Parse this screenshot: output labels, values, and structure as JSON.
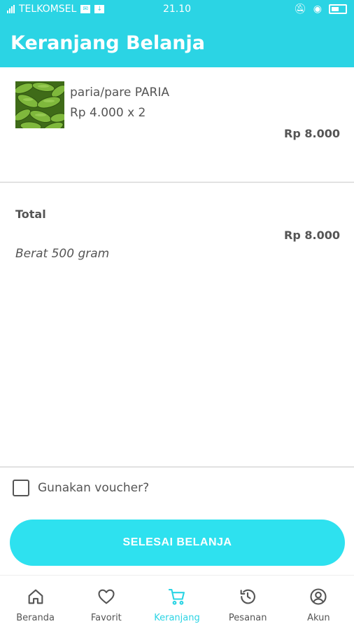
{
  "status_bar": {
    "carrier": "TELKOMSEL",
    "time": "21.10"
  },
  "header": {
    "title": "Keranjang Belanja"
  },
  "cart": {
    "items": [
      {
        "name": "paria/pare PARIA",
        "price_qty": "Rp 4.000 x 2",
        "subtotal": "Rp 8.000",
        "image": "bitter-gourd-photo"
      }
    ],
    "total_label": "Total",
    "total_value": "Rp 8.000",
    "weight": "Berat 500 gram"
  },
  "voucher": {
    "label": "Gunakan voucher?",
    "checked": false
  },
  "checkout_button": {
    "label": "SELESAI BELANJA"
  },
  "colors": {
    "primary": "#2bd4e4",
    "button": "#2ee1ef",
    "text": "#555555"
  },
  "bottom_nav": [
    {
      "label": "Beranda",
      "icon": "home-icon",
      "active": false
    },
    {
      "label": "Favorit",
      "icon": "heart-icon",
      "active": false
    },
    {
      "label": "Keranjang",
      "icon": "cart-icon",
      "active": true
    },
    {
      "label": "Pesanan",
      "icon": "history-icon",
      "active": false
    },
    {
      "label": "Akun",
      "icon": "account-icon",
      "active": false
    }
  ]
}
